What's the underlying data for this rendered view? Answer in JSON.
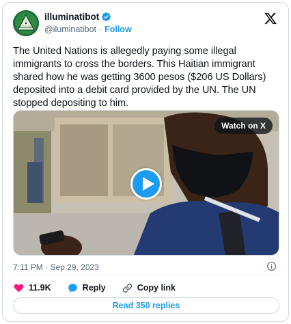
{
  "author": {
    "display_name": "illuminatibot",
    "handle": "@iluminatibot",
    "separator": "·",
    "follow_label": "Follow",
    "verified": true,
    "verified_color": "#1d9bf0"
  },
  "tweet": {
    "text": "The United Nations is allegedly paying some illegal immigrants to cross the borders. This Haitian immigrant shared how he was getting 3600 pesos ($206 US Dollars) deposited into a debit card provided by the UN. The UN stopped depositing to him.",
    "timestamp": "7:11 PM · Sep 29, 2023"
  },
  "media": {
    "watch_label": "Watch on X",
    "play_icon": "play-icon"
  },
  "actions": {
    "likes_count": "11.9K",
    "reply_label": "Reply",
    "copy_link_label": "Copy link",
    "read_replies_label": "Read 350 replies"
  },
  "colors": {
    "accent": "#1d9bf0",
    "like": "#f91880",
    "text": "#0f1419",
    "secondary": "#536471"
  }
}
